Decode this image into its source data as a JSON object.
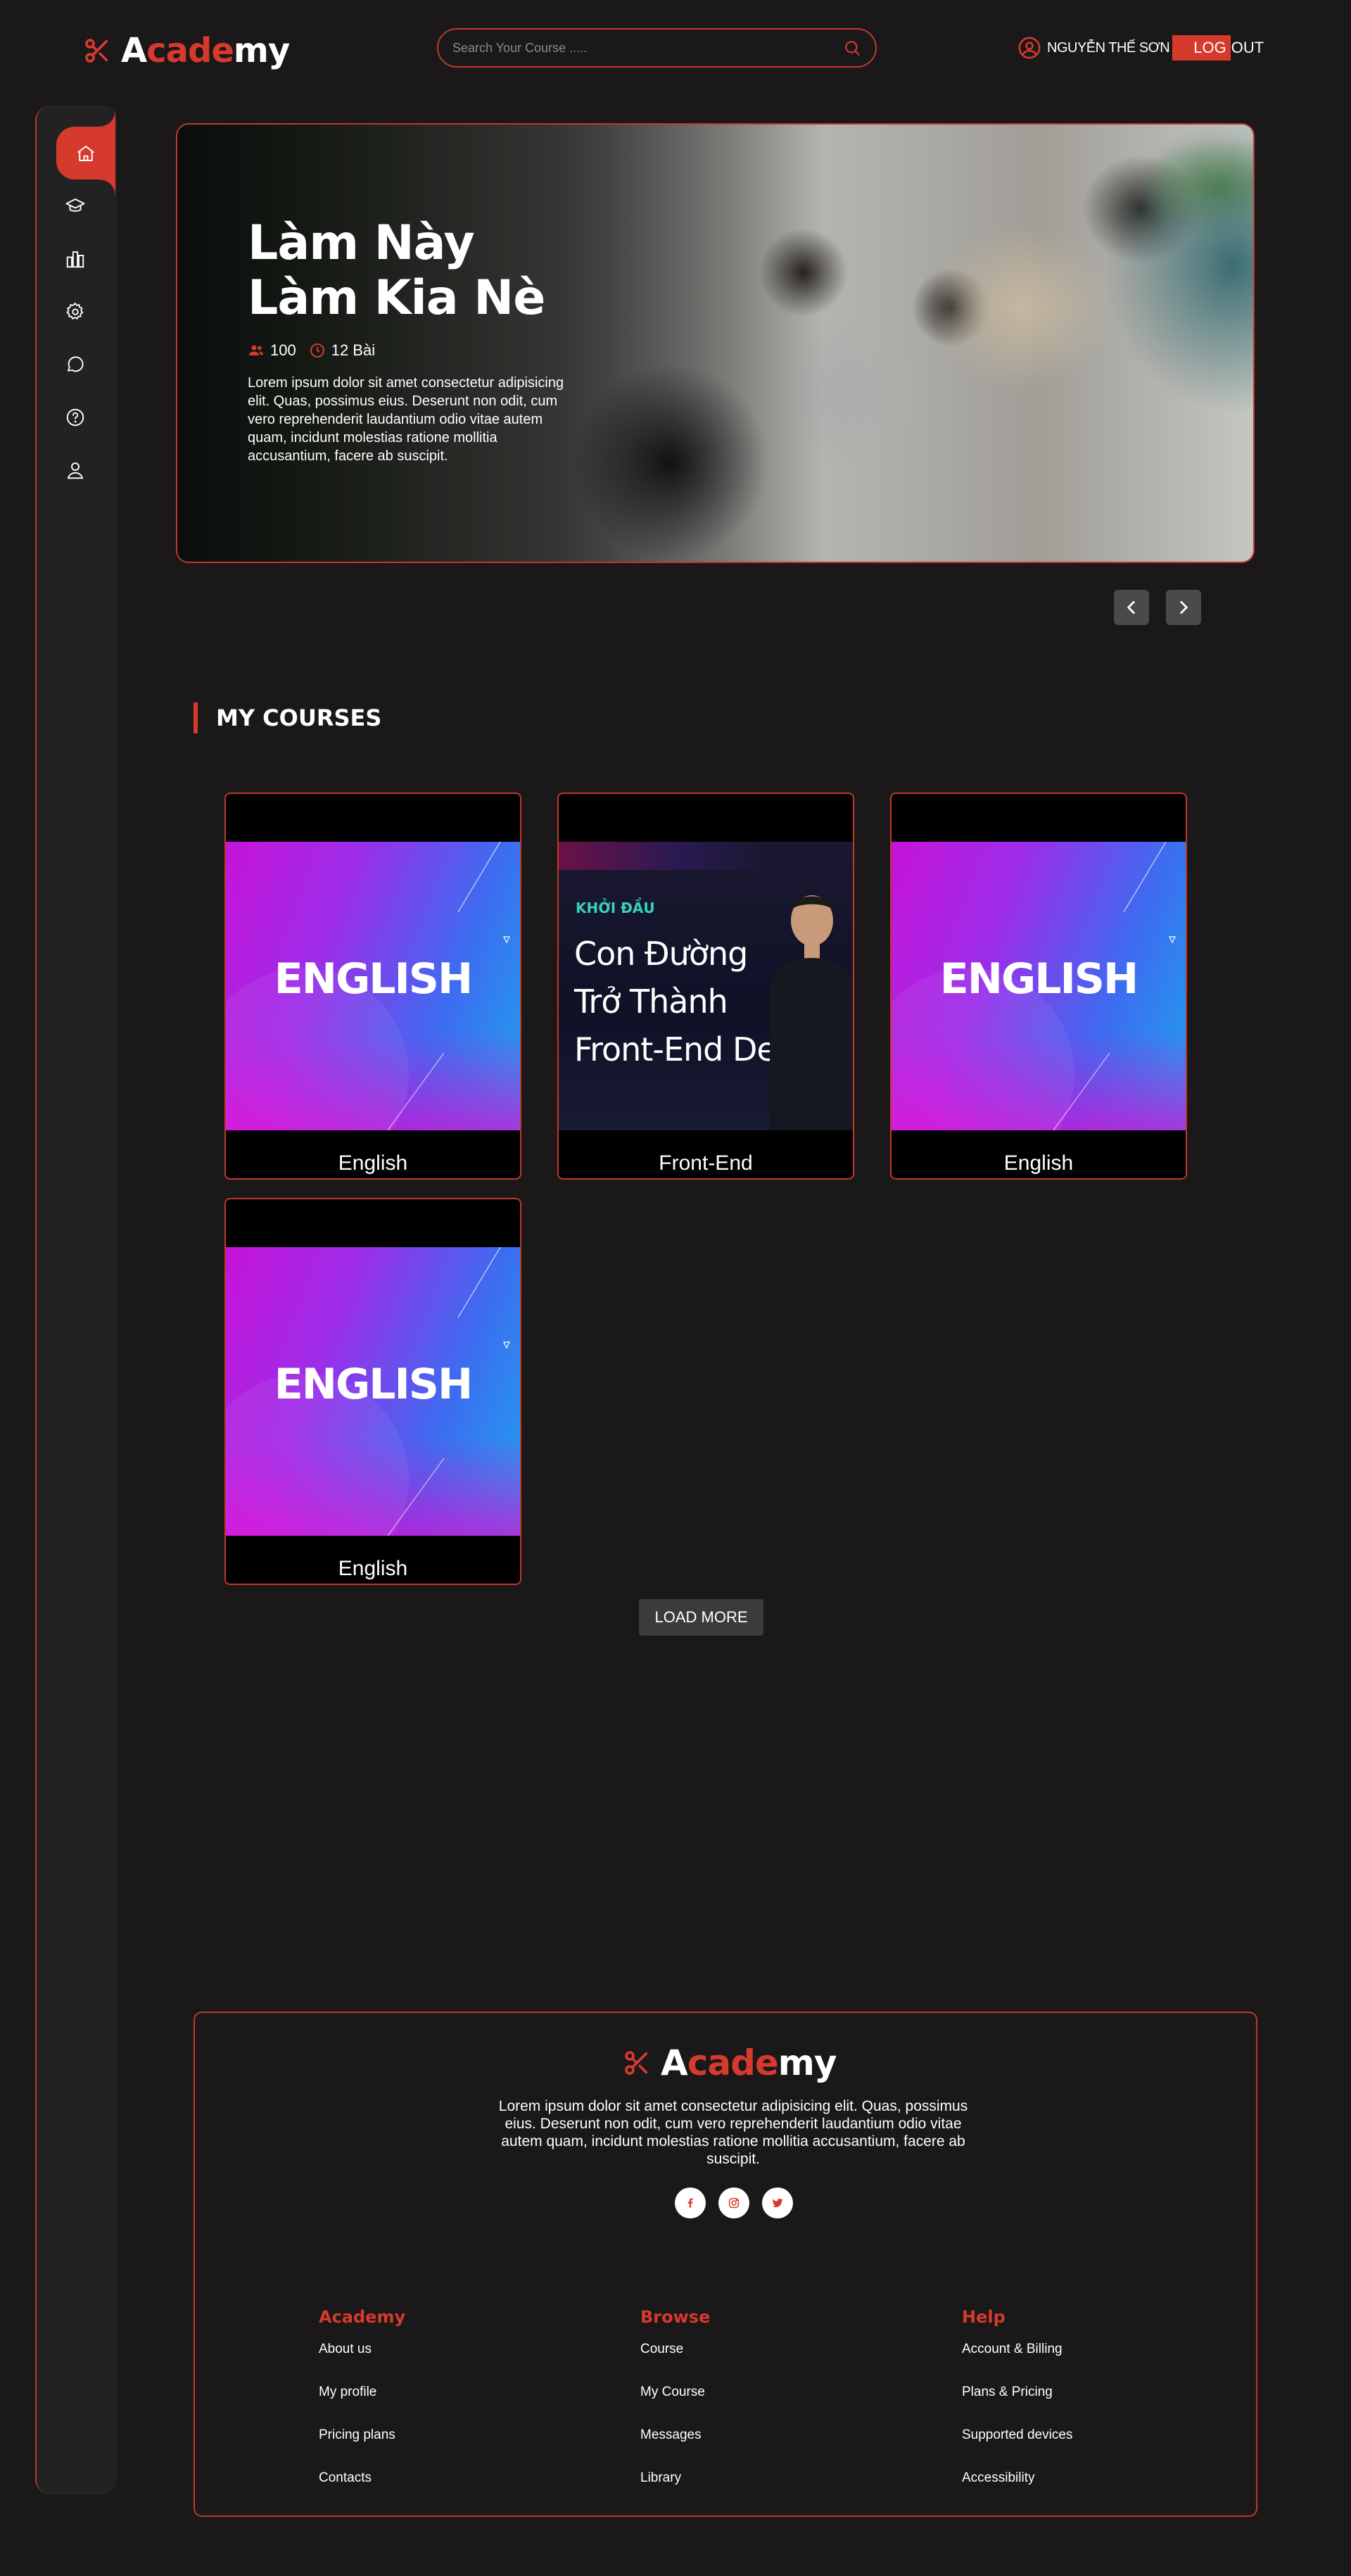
{
  "header": {
    "logo": {
      "a": "A",
      "cade": "cade",
      "my": "my"
    },
    "search_placeholder": "Search Your Course .....",
    "user_name": "NGUYỄN THẾ SƠN",
    "logout_log": "LOG",
    "logout_out": "OUT"
  },
  "sidebar": {
    "items": [
      {
        "name": "home",
        "icon": "home-icon",
        "active": true
      },
      {
        "name": "courses",
        "icon": "graduation-cap-icon"
      },
      {
        "name": "stats",
        "icon": "bar-chart-icon"
      },
      {
        "name": "settings",
        "icon": "gear-icon"
      },
      {
        "name": "messages",
        "icon": "chat-icon"
      },
      {
        "name": "help",
        "icon": "help-circle-icon"
      },
      {
        "name": "profile",
        "icon": "user-icon"
      }
    ]
  },
  "hero": {
    "title": "Làm Này Làm Kia Nè",
    "students": "100",
    "lessons": "12 Bài",
    "description": "Lorem ipsum dolor sit amet consectetur adipisicing elit. Quas, possimus eius. Deserunt non odit, cum vero reprehenderit laudantium odio vitae autem quam, incidunt molestias ratione mollitia accusantium, facere ab suscipit.",
    "prev_icon": "chevron-left-icon",
    "next_icon": "chevron-right-icon"
  },
  "courses": {
    "title": "MY COURSES",
    "items": [
      {
        "name": "English",
        "thumb_text": "ENGLISH"
      },
      {
        "name": "Front-End",
        "kicker": "KHỞI ĐẦU",
        "thumb_title_1": "Con Đường",
        "thumb_title_2": "Trở Thành",
        "thumb_title_3": "Front-End Dev"
      },
      {
        "name": "English",
        "thumb_text": "ENGLISH"
      },
      {
        "name": "English",
        "thumb_text": "ENGLISH"
      }
    ],
    "load_more": "LOAD MORE"
  },
  "footer": {
    "logo": {
      "a": "A",
      "cade": "cade",
      "my": "my"
    },
    "description": "Lorem ipsum dolor sit amet consectetur adipisicing elit. Quas, possimus eius. Deserunt non odit, cum vero reprehenderit laudantium odio vitae autem quam, incidunt molestias ratione mollitia accusantium, facere ab suscipit.",
    "socials": [
      "facebook-icon",
      "instagram-icon",
      "twitter-icon"
    ],
    "columns": [
      {
        "title": "Academy",
        "links": [
          "About us",
          "My profile",
          "Pricing plans",
          "Contacts"
        ]
      },
      {
        "title": "Browse",
        "links": [
          "Course",
          "My Course",
          "Messages",
          "Library"
        ]
      },
      {
        "title": "Help",
        "links": [
          "Account & Billing",
          "Plans & Pricing",
          "Supported devices",
          "Accessibility"
        ]
      }
    ]
  },
  "colors": {
    "accent": "#d63a2c",
    "background": "#1a1819",
    "sidebar": "#232223"
  }
}
